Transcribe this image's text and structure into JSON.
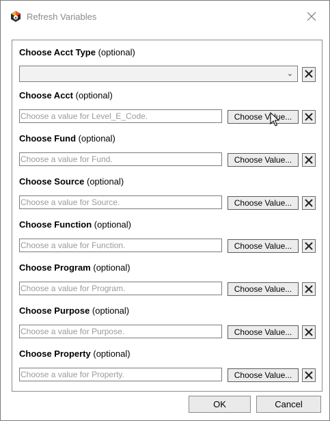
{
  "window": {
    "title": "Refresh Variables",
    "close_icon": "close-icon",
    "app_icon": "app-logo-icon"
  },
  "fields": {
    "acct_type": {
      "label": "Choose Acct Type",
      "optional": "(optional)",
      "value": ""
    },
    "acct": {
      "label": "Choose Acct",
      "optional": "(optional)",
      "placeholder": "Choose a value for Level_E_Code.",
      "button": "Choose Value..."
    },
    "fund": {
      "label": "Choose Fund",
      "optional": "(optional)",
      "placeholder": "Choose a value for Fund.",
      "button": "Choose Value..."
    },
    "source": {
      "label": "Choose Source",
      "optional": "(optional)",
      "placeholder": "Choose a value for Source.",
      "button": "Choose Value..."
    },
    "function": {
      "label": "Choose Function",
      "optional": "(optional)",
      "placeholder": "Choose a value for Function.",
      "button": "Choose Value..."
    },
    "program": {
      "label": "Choose Program",
      "optional": "(optional)",
      "placeholder": "Choose a value for Program.",
      "button": "Choose Value..."
    },
    "purpose": {
      "label": "Choose Purpose",
      "optional": "(optional)",
      "placeholder": "Choose a value for Purpose.",
      "button": "Choose Value..."
    },
    "property": {
      "label": "Choose Property",
      "optional": "(optional)",
      "placeholder": "Choose a value for Property.",
      "button": "Choose Value..."
    }
  },
  "footer": {
    "ok_label": "OK",
    "cancel_label": "Cancel"
  }
}
